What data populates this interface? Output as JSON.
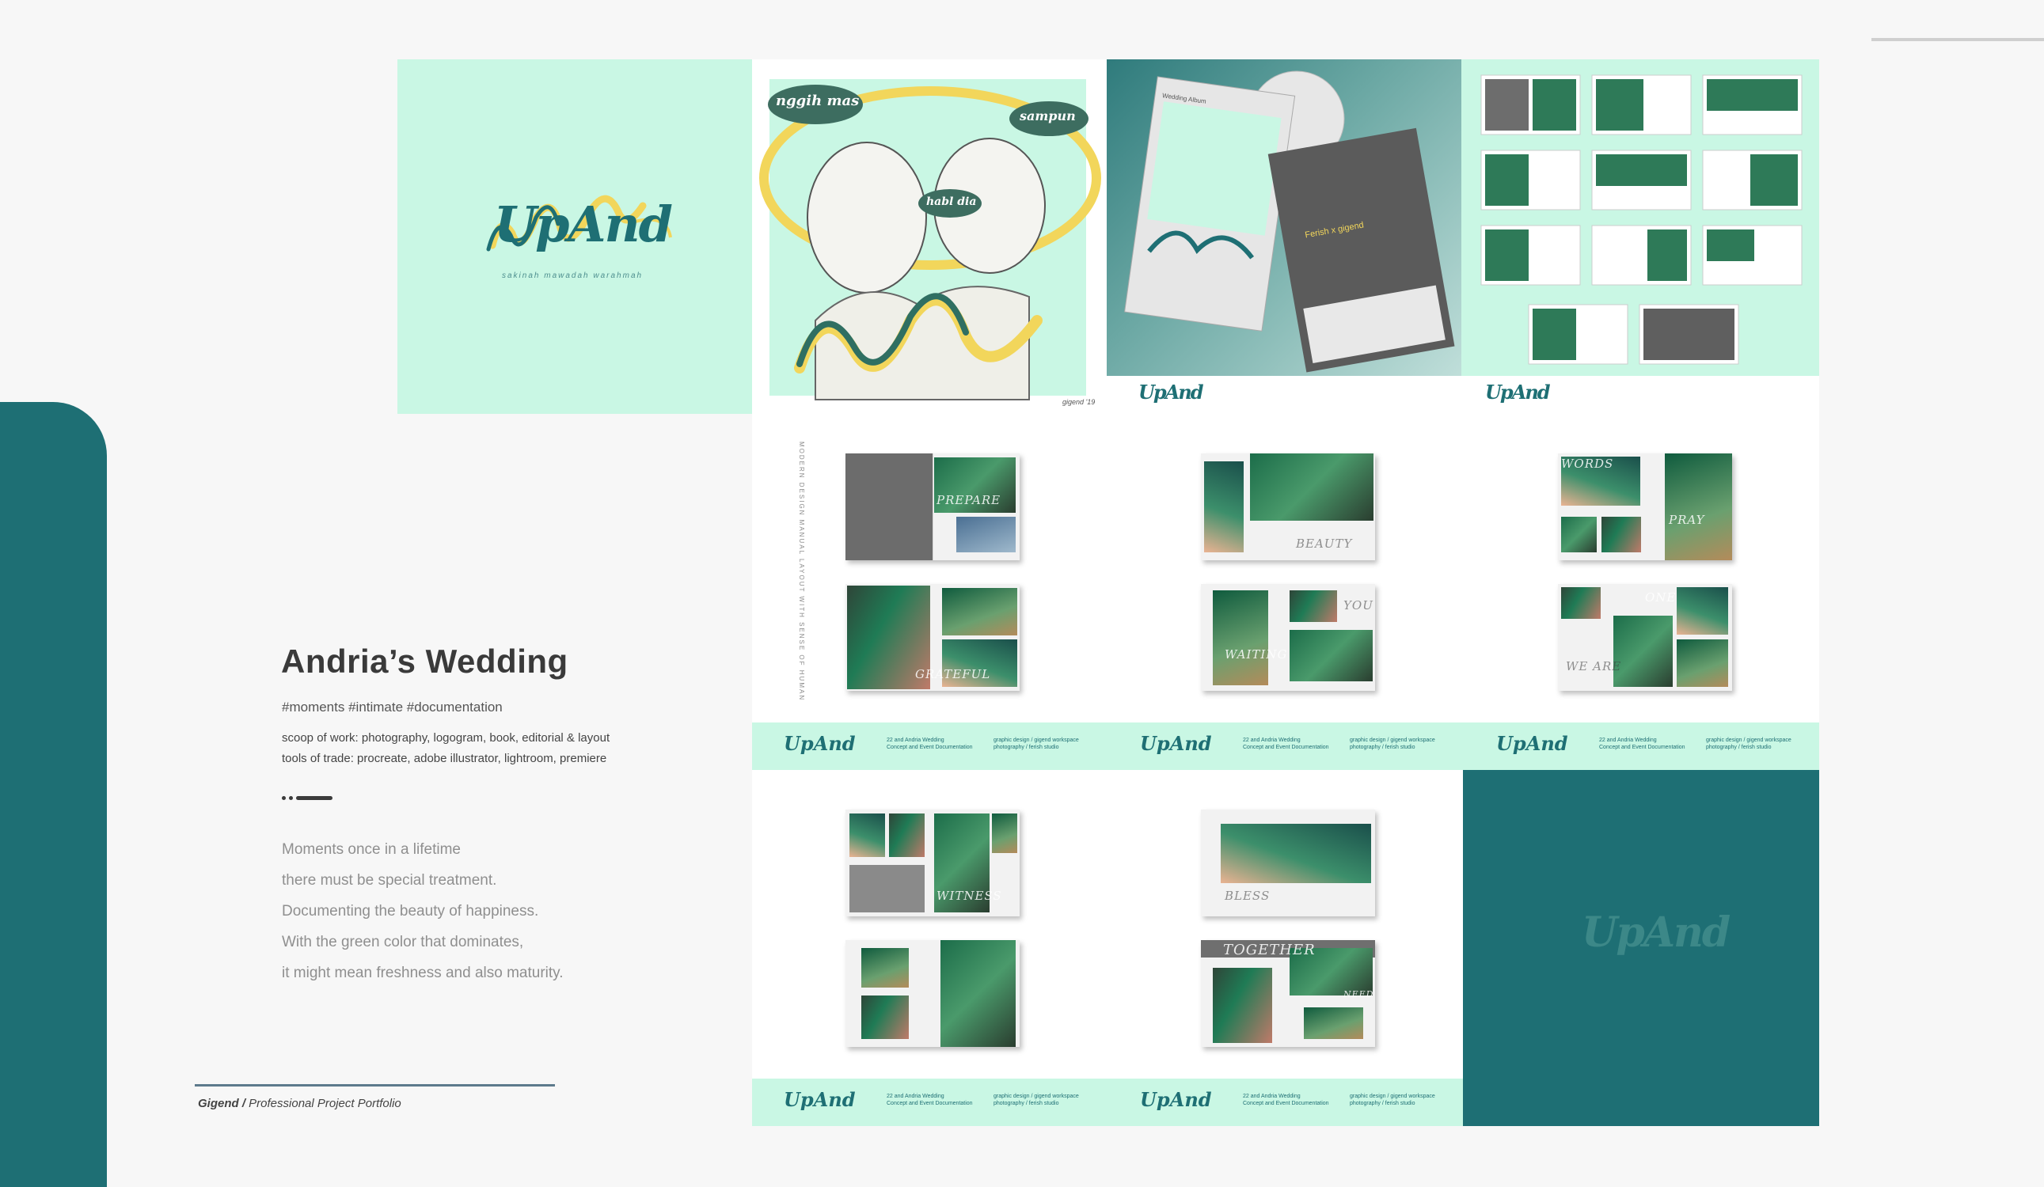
{
  "project": {
    "title": "Andria’s Wedding",
    "tags": "#moments #intimate #documentation",
    "scope": "scoop of work: photography, logogram, book, editorial & layout",
    "tools": "tools of trade: procreate, adobe illustrator, lightroom, premiere",
    "poem": [
      "Moments once in a lifetime",
      "there must be special treatment.",
      "Documenting the beauty of happiness.",
      "With the green color that dominates,",
      "it might mean freshness and also maturity."
    ]
  },
  "footer": {
    "brand": "Gigend /",
    "subtitle": "Professional Project Portfolio"
  },
  "logo": {
    "script": "UpAnd",
    "tagline": "sakinah mawadah warahmah"
  },
  "illustration": {
    "bubble_left": "nggih mas",
    "bubble_right": "sampun",
    "bubble_center": "habl dia",
    "signature": "gigend '19"
  },
  "mockup": {
    "cover_label": "Wedding Album",
    "box_label": "Ferish x gigend"
  },
  "strip": {
    "line1": "22 and Andria Wedding",
    "line2": "Concept and Event Documentation",
    "line3": "graphic design / gigend workspace",
    "line4": "photography / ferish studio"
  },
  "spread_words": {
    "prepare": "PREPARE",
    "beauty": "BEAUTY",
    "words": "WORDS",
    "pray": "PRAY",
    "grateful": "GRATEFUL",
    "waiting": "WAITING",
    "you": "YOU",
    "one": "ONE",
    "we_are": "WE ARE",
    "witness": "WITNESS",
    "bless": "BLESS",
    "together": "TOGETHER",
    "need": "NEED"
  },
  "side_text": "MODERN DESIGN MANUAL LAYOUT WITH SENSE OF HUMAN",
  "colors": {
    "teal": "#1e6f74",
    "mint": "#c9f7e4",
    "yellow": "#f2d65b",
    "background": "#f7f7f7"
  }
}
